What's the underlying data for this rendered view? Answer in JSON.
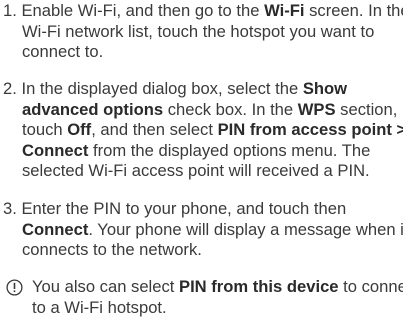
{
  "steps": [
    {
      "number": "1.",
      "lines": [
        [
          {
            "t": "Enable Wi-Fi, and then go to the "
          },
          {
            "t": "Wi-Fi",
            "b": true
          },
          {
            "t": " screen. In the"
          }
        ],
        [
          {
            "t": "Wi-Fi network list, touch the hotspot you want to"
          }
        ],
        [
          {
            "t": "connect to."
          }
        ]
      ]
    },
    {
      "number": "2.",
      "lines": [
        [
          {
            "t": "In the displayed dialog box, select the "
          },
          {
            "t": "Show",
            "b": true
          }
        ],
        [
          {
            "t": "advanced options",
            "b": true
          },
          {
            "t": " check box. In the "
          },
          {
            "t": "WPS",
            "b": true
          },
          {
            "t": " section,"
          }
        ],
        [
          {
            "t": "touch "
          },
          {
            "t": "Off",
            "b": true
          },
          {
            "t": ", and then select "
          },
          {
            "t": "PIN from access point >",
            "b": true
          }
        ],
        [
          {
            "t": "Connect",
            "b": true
          },
          {
            "t": " from the displayed options menu. The"
          }
        ],
        [
          {
            "t": "selected Wi-Fi access point will received a PIN."
          }
        ]
      ]
    },
    {
      "number": "3.",
      "lines": [
        [
          {
            "t": "Enter the PIN to your phone, and touch then"
          }
        ],
        [
          {
            "t": "Connect",
            "b": true
          },
          {
            "t": ". Your phone will display a message when it"
          }
        ],
        [
          {
            "t": "connects to the network."
          }
        ]
      ]
    }
  ],
  "note": {
    "icon": "info-icon",
    "lines": [
      [
        {
          "t": "You also can select "
        },
        {
          "t": "PIN from this device",
          "b": true
        },
        {
          "t": " to connect"
        }
      ],
      [
        {
          "t": "to a Wi-Fi hotspot."
        }
      ]
    ]
  }
}
